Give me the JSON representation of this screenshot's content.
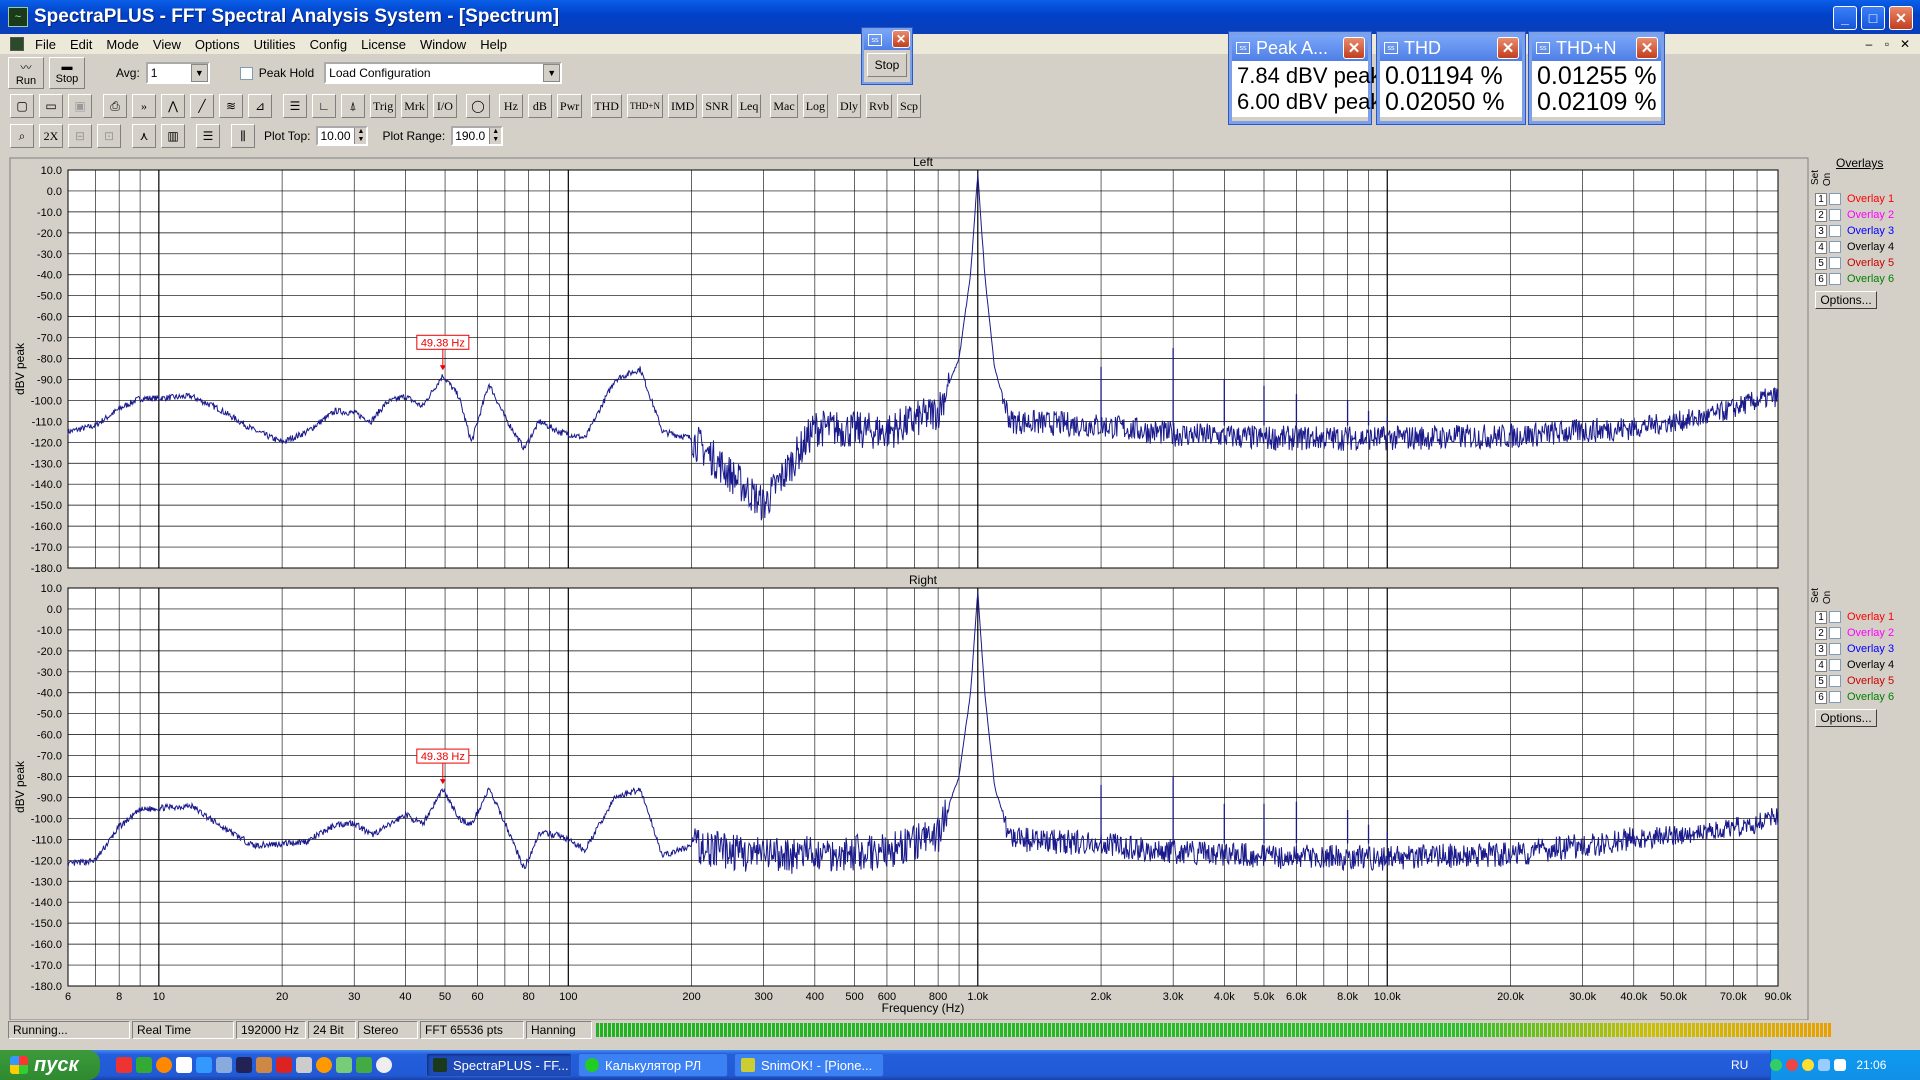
{
  "window": {
    "title": "SpectraPLUS - FFT Spectral Analysis System - [Spectrum]"
  },
  "menu": [
    "File",
    "Edit",
    "Mode",
    "View",
    "Options",
    "Utilities",
    "Config",
    "License",
    "Window",
    "Help"
  ],
  "toolbar": {
    "run_label": "Run",
    "stop_label": "Stop",
    "avg_label": "Avg:",
    "avg_value": "1",
    "peak_hold_label": "Peak Hold",
    "load_config": "Load Configuration",
    "buttons": [
      "Trig",
      "Mrk",
      "I/O",
      "Hz",
      "dB",
      "Pwr",
      "THD",
      "THD+N",
      "IMD",
      "SNR",
      "Leq",
      "Mac",
      "Log",
      "Dly",
      "Rvb",
      "Scp"
    ],
    "plot_top_label": "Plot Top:",
    "plot_top_value": "10.00",
    "plot_range_label": "Plot Range:",
    "plot_range_value": "190.0"
  },
  "stop_window": {
    "button": "Stop"
  },
  "meters": [
    {
      "title": "Peak A...",
      "values": [
        "7.84 dBV peak",
        "6.00 dBV peak"
      ]
    },
    {
      "title": "THD",
      "values": [
        "0.01194 %",
        "0.02050 %"
      ]
    },
    {
      "title": "THD+N",
      "values": [
        "0.01255 %",
        "0.02109 %"
      ]
    }
  ],
  "chart_data": [
    {
      "type": "line",
      "title": "Left",
      "ylabel": "dBV peak",
      "xlabel": "Frequency (Hz)",
      "x_scale": "log",
      "xlim": [
        6,
        90000
      ],
      "ylim": [
        -180,
        10
      ],
      "y_ticks": [
        "10.0",
        "0.0",
        "-10.0",
        "-20.0",
        "-30.0",
        "-40.0",
        "-50.0",
        "-60.0",
        "-70.0",
        "-80.0",
        "-90.0",
        "-100.0",
        "-110.0",
        "-120.0",
        "-130.0",
        "-140.0",
        "-150.0",
        "-160.0",
        "-170.0",
        "-180.0"
      ],
      "marker": {
        "label": "49.38 Hz",
        "x": 49.38,
        "y": -88
      },
      "series": [
        {
          "points": [
            [
              6,
              -115
            ],
            [
              7,
              -112
            ],
            [
              8,
              -104
            ],
            [
              9,
              -99
            ],
            [
              10,
              -99
            ],
            [
              12,
              -98
            ],
            [
              14,
              -104
            ],
            [
              17,
              -114
            ],
            [
              20,
              -120
            ],
            [
              23,
              -115
            ],
            [
              27,
              -105
            ],
            [
              30,
              -106
            ],
            [
              33,
              -110
            ],
            [
              36,
              -101
            ],
            [
              40,
              -98
            ],
            [
              44,
              -103
            ],
            [
              49.38,
              -88
            ],
            [
              54,
              -98
            ],
            [
              58,
              -120
            ],
            [
              64,
              -92
            ],
            [
              70,
              -108
            ],
            [
              78,
              -123
            ],
            [
              85,
              -110
            ],
            [
              95,
              -115
            ],
            [
              110,
              -118
            ],
            [
              130,
              -90
            ],
            [
              150,
              -85
            ],
            [
              170,
              -115
            ],
            [
              200,
              -118
            ],
            [
              300,
              -150
            ],
            [
              400,
              -113
            ],
            [
              600,
              -115
            ],
            [
              800,
              -105
            ],
            [
              900,
              -80
            ],
            [
              960,
              -40
            ],
            [
              1000,
              8
            ],
            [
              1040,
              -40
            ],
            [
              1100,
              -85
            ],
            [
              1200,
              -110
            ],
            [
              2000,
              -112
            ],
            [
              3000,
              -116
            ],
            [
              5000,
              -118
            ],
            [
              10000,
              -118
            ],
            [
              20000,
              -117
            ],
            [
              40000,
              -113
            ],
            [
              60000,
              -108
            ],
            [
              80000,
              -100
            ],
            [
              90000,
              -98
            ]
          ]
        }
      ],
      "harmonics": [
        [
          2000,
          -84
        ],
        [
          3000,
          -75
        ],
        [
          4000,
          -90
        ],
        [
          5000,
          -93
        ],
        [
          6000,
          -97
        ],
        [
          8000,
          -100
        ],
        [
          9000,
          -105
        ],
        [
          10000,
          -108
        ]
      ]
    },
    {
      "type": "line",
      "title": "Right",
      "ylabel": "dBV peak",
      "xlabel": "Frequency (Hz)",
      "x_scale": "log",
      "xlim": [
        6,
        90000
      ],
      "ylim": [
        -180,
        10
      ],
      "y_ticks": [
        "10.0",
        "0.0",
        "-10.0",
        "-20.0",
        "-30.0",
        "-40.0",
        "-50.0",
        "-60.0",
        "-70.0",
        "-80.0",
        "-90.0",
        "-100.0",
        "-110.0",
        "-120.0",
        "-130.0",
        "-140.0",
        "-150.0",
        "-160.0",
        "-170.0",
        "-180.0"
      ],
      "marker": {
        "label": "49.38 Hz",
        "x": 49.38,
        "y": -86
      },
      "series": [
        {
          "points": [
            [
              6,
              -122
            ],
            [
              7,
              -120
            ],
            [
              8,
              -104
            ],
            [
              9,
              -96
            ],
            [
              10,
              -95
            ],
            [
              12,
              -94
            ],
            [
              14,
              -103
            ],
            [
              17,
              -113
            ],
            [
              20,
              -112
            ],
            [
              23,
              -111
            ],
            [
              27,
              -103
            ],
            [
              30,
              -102
            ],
            [
              33,
              -108
            ],
            [
              36,
              -104
            ],
            [
              40,
              -98
            ],
            [
              44,
              -103
            ],
            [
              49.38,
              -86
            ],
            [
              54,
              -100
            ],
            [
              58,
              -103
            ],
            [
              64,
              -86
            ],
            [
              70,
              -102
            ],
            [
              78,
              -124
            ],
            [
              85,
              -107
            ],
            [
              95,
              -108
            ],
            [
              110,
              -115
            ],
            [
              130,
              -90
            ],
            [
              150,
              -86
            ],
            [
              170,
              -118
            ],
            [
              200,
              -113
            ],
            [
              300,
              -118
            ],
            [
              400,
              -117
            ],
            [
              600,
              -116
            ],
            [
              800,
              -108
            ],
            [
              900,
              -80
            ],
            [
              960,
              -40
            ],
            [
              1000,
              8
            ],
            [
              1040,
              -40
            ],
            [
              1100,
              -85
            ],
            [
              1200,
              -110
            ],
            [
              2000,
              -112
            ],
            [
              3000,
              -116
            ],
            [
              5000,
              -118
            ],
            [
              10000,
              -119
            ],
            [
              20000,
              -117
            ],
            [
              40000,
              -110
            ],
            [
              60000,
              -107
            ],
            [
              80000,
              -102
            ],
            [
              90000,
              -99
            ]
          ]
        }
      ],
      "harmonics": [
        [
          2000,
          -84
        ],
        [
          3000,
          -80
        ],
        [
          4000,
          -93
        ],
        [
          5000,
          -93
        ],
        [
          6000,
          -92
        ],
        [
          8000,
          -96
        ],
        [
          9000,
          -103
        ],
        [
          10000,
          -106
        ]
      ]
    }
  ],
  "x_tick_labels": [
    [
      "6",
      6
    ],
    [
      "8",
      8
    ],
    [
      "10",
      10
    ],
    [
      "20",
      20
    ],
    [
      "30",
      30
    ],
    [
      "40",
      40
    ],
    [
      "50",
      50
    ],
    [
      "60",
      60
    ],
    [
      "80",
      80
    ],
    [
      "100",
      100
    ],
    [
      "200",
      200
    ],
    [
      "300",
      300
    ],
    [
      "400",
      400
    ],
    [
      "500",
      500
    ],
    [
      "600",
      600
    ],
    [
      "800",
      800
    ],
    [
      "1.0k",
      1000
    ],
    [
      "2.0k",
      2000
    ],
    [
      "3.0k",
      3000
    ],
    [
      "4.0k",
      4000
    ],
    [
      "5.0k",
      5000
    ],
    [
      "6.0k",
      6000
    ],
    [
      "8.0k",
      8000
    ],
    [
      "10.0k",
      10000
    ],
    [
      "20.0k",
      20000
    ],
    [
      "30.0k",
      30000
    ],
    [
      "40.0k",
      40000
    ],
    [
      "50.0k",
      50000
    ],
    [
      "70.0k",
      70000
    ],
    [
      "90.0k",
      90000
    ]
  ],
  "overlays": {
    "header": "Overlays",
    "set_label": "Set",
    "on_label": "On",
    "items": [
      {
        "n": "1",
        "label": "Overlay 1",
        "color": "#ff0000"
      },
      {
        "n": "2",
        "label": "Overlay 2",
        "color": "#ff00ff"
      },
      {
        "n": "3",
        "label": "Overlay 3",
        "color": "#0000ff"
      },
      {
        "n": "4",
        "label": "Overlay 4",
        "color": "#000000"
      },
      {
        "n": "5",
        "label": "Overlay 5",
        "color": "#cc0000"
      },
      {
        "n": "6",
        "label": "Overlay 6",
        "color": "#008000"
      }
    ],
    "options_label": "Options..."
  },
  "status": [
    "Running...",
    "Real Time",
    "192000 Hz",
    "24 Bit",
    "Stereo",
    "FFT 65536 pts",
    "Hanning"
  ],
  "taskbar": {
    "start": "пуск",
    "tasks": [
      "SpectraPLUS - FF...",
      "Калькулятор РЛ",
      "SnimOK! - [Pione..."
    ],
    "lang": "RU",
    "clock": "21:06"
  }
}
